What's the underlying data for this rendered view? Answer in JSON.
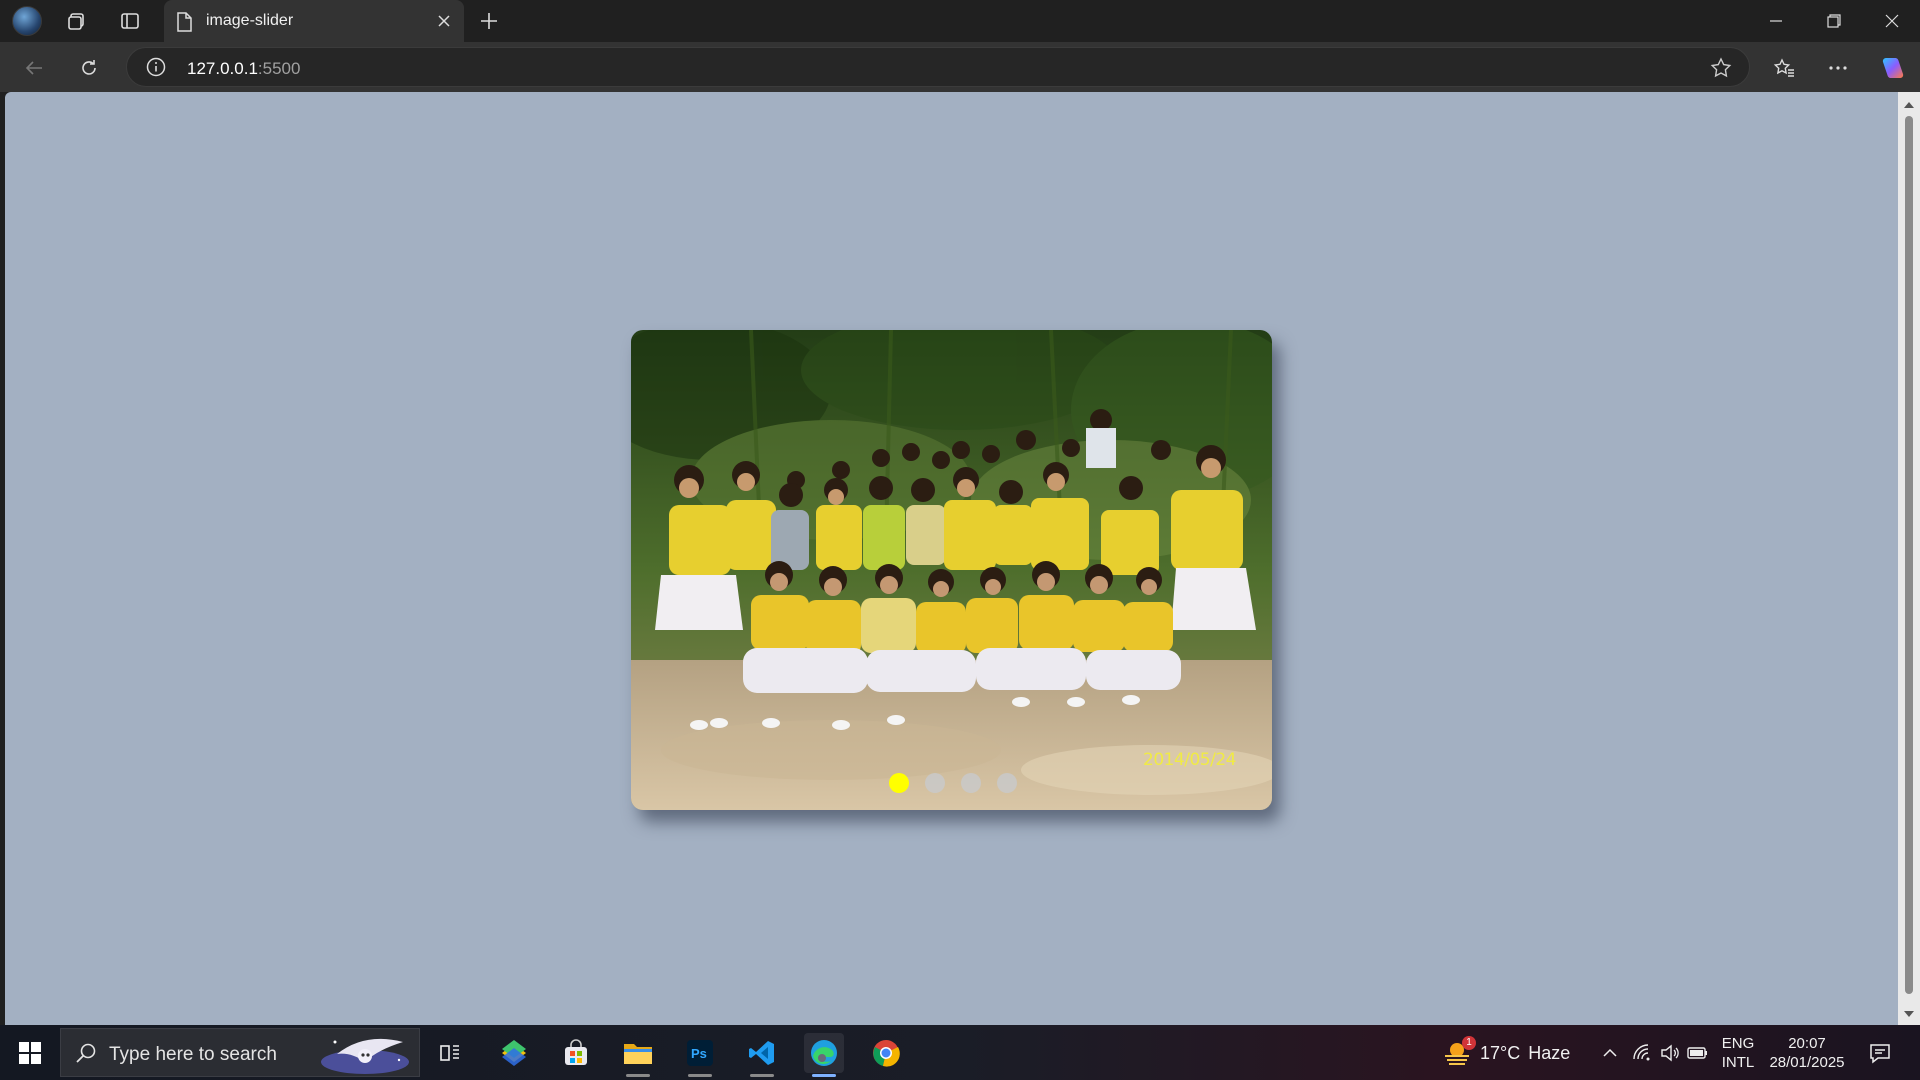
{
  "browser": {
    "tab_title": "image-slider",
    "url_host": "127.0.0.1",
    "url_port": ":5500"
  },
  "slider": {
    "photo_date_stamp": "2014/05/24",
    "dots": [
      {
        "active": true
      },
      {
        "active": false
      },
      {
        "active": false
      },
      {
        "active": false
      }
    ],
    "active_color": "#ffff00",
    "page_background": "#a3b0c2"
  },
  "taskbar": {
    "search_placeholder": "Type here to search",
    "apps": [
      "task-view",
      "bluestacks",
      "microsoft-store",
      "file-explorer",
      "photoshop",
      "vscode",
      "edge",
      "chrome"
    ],
    "weather": {
      "temp": "17°C",
      "condition": "Haze",
      "alert_count": "1"
    },
    "language": {
      "lang": "ENG",
      "layout": "INTL"
    },
    "clock": {
      "time": "20:07",
      "date": "28/01/2025"
    }
  }
}
